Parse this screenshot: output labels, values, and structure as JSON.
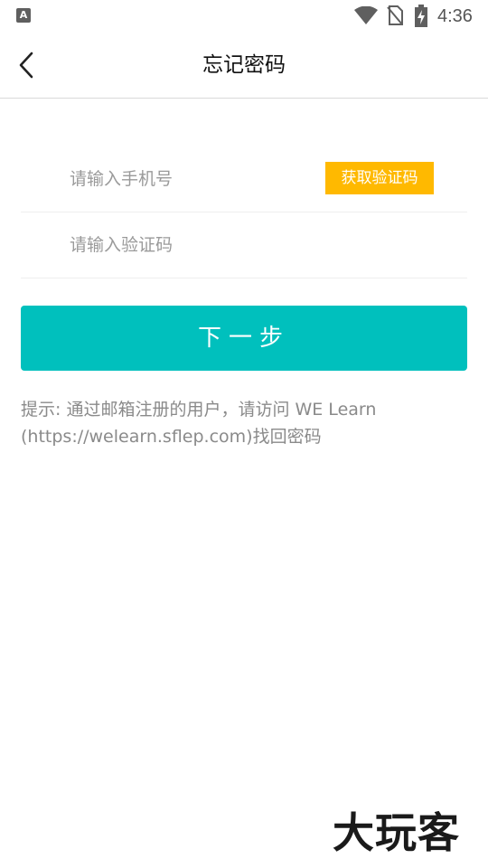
{
  "status_bar": {
    "app_icon_letter": "A",
    "time": "4:36"
  },
  "header": {
    "title": "忘记密码"
  },
  "form": {
    "phone_placeholder": "请输入手机号",
    "get_code_label": "获取验证码",
    "code_placeholder": "请输入验证码",
    "next_label": "下一步"
  },
  "hint": {
    "line1": "提示: 通过邮箱注册的用户，请访问 WE Learn",
    "line2": "(https://welearn.sflep.com)找回密码"
  },
  "watermark": {
    "text": "大玩客"
  },
  "colors": {
    "accent": "#00c0bd",
    "code_button": "#ffb900"
  },
  "icons": {
    "back": "chevron-left-icon",
    "wifi": "wifi-icon",
    "sim": "no-sim-icon",
    "battery": "battery-charging-icon"
  }
}
